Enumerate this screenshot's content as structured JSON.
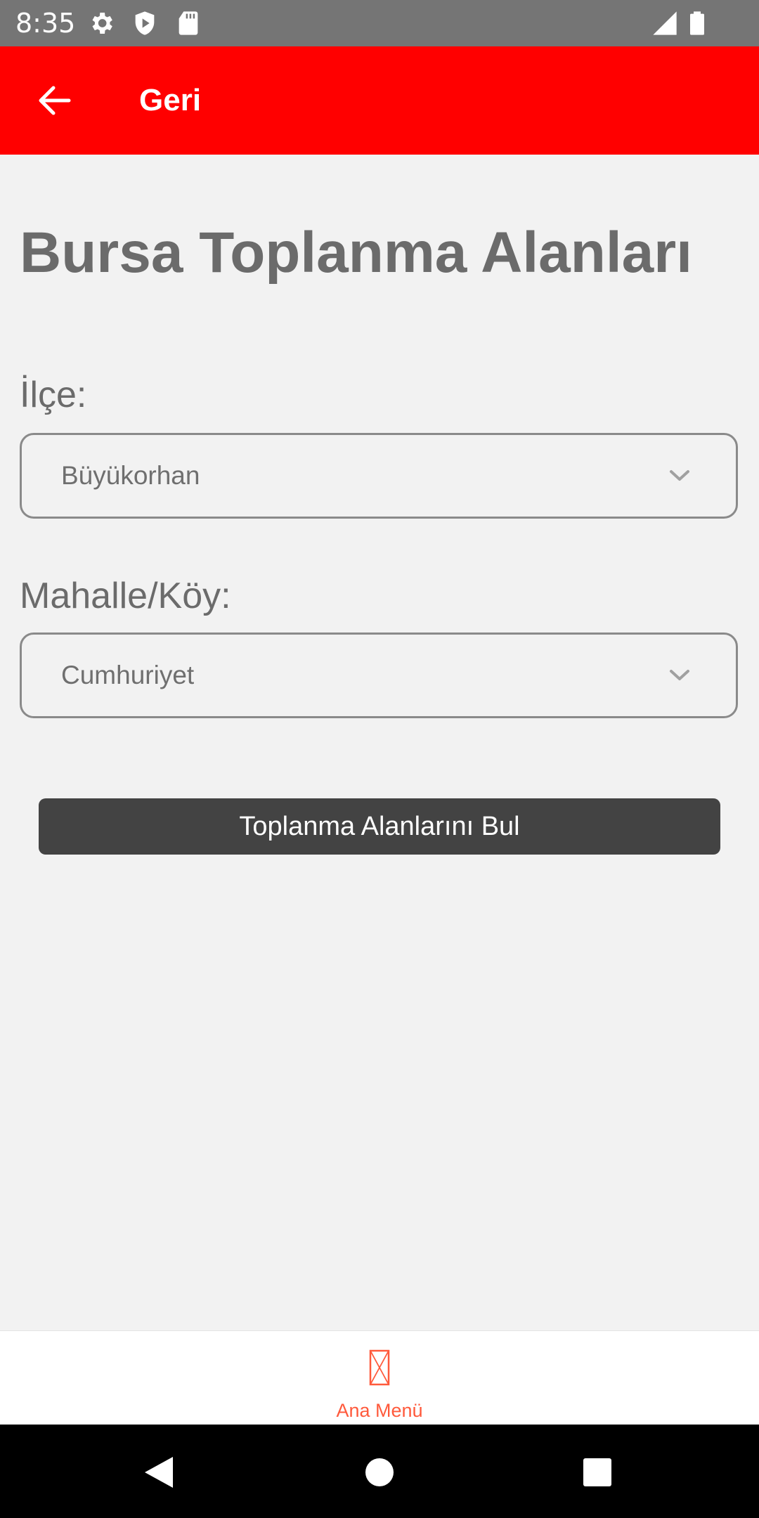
{
  "status_bar": {
    "time": "8:35",
    "icons": [
      "gear-icon",
      "shield-icon",
      "sd-card-icon",
      "signal-icon",
      "battery-icon"
    ]
  },
  "app_bar": {
    "back_icon": "arrow-left-icon",
    "title": "Geri",
    "background": "#ff0000"
  },
  "main": {
    "title": "Bursa Toplanma Alanları",
    "district": {
      "label": "İlçe:",
      "value": "Büyükorhan"
    },
    "neighborhood": {
      "label": "Mahalle/Köy:",
      "value": "Cumhuriyet"
    },
    "find_button": "Toplanma Alanlarını Bul"
  },
  "bottom_nav": {
    "items": [
      {
        "label": "Ana Menü",
        "icon": "missing-glyph-icon",
        "color": "#ff5a3c"
      }
    ]
  },
  "system_nav": {
    "buttons": [
      "back-triangle-icon",
      "home-circle-icon",
      "recents-square-icon"
    ]
  }
}
